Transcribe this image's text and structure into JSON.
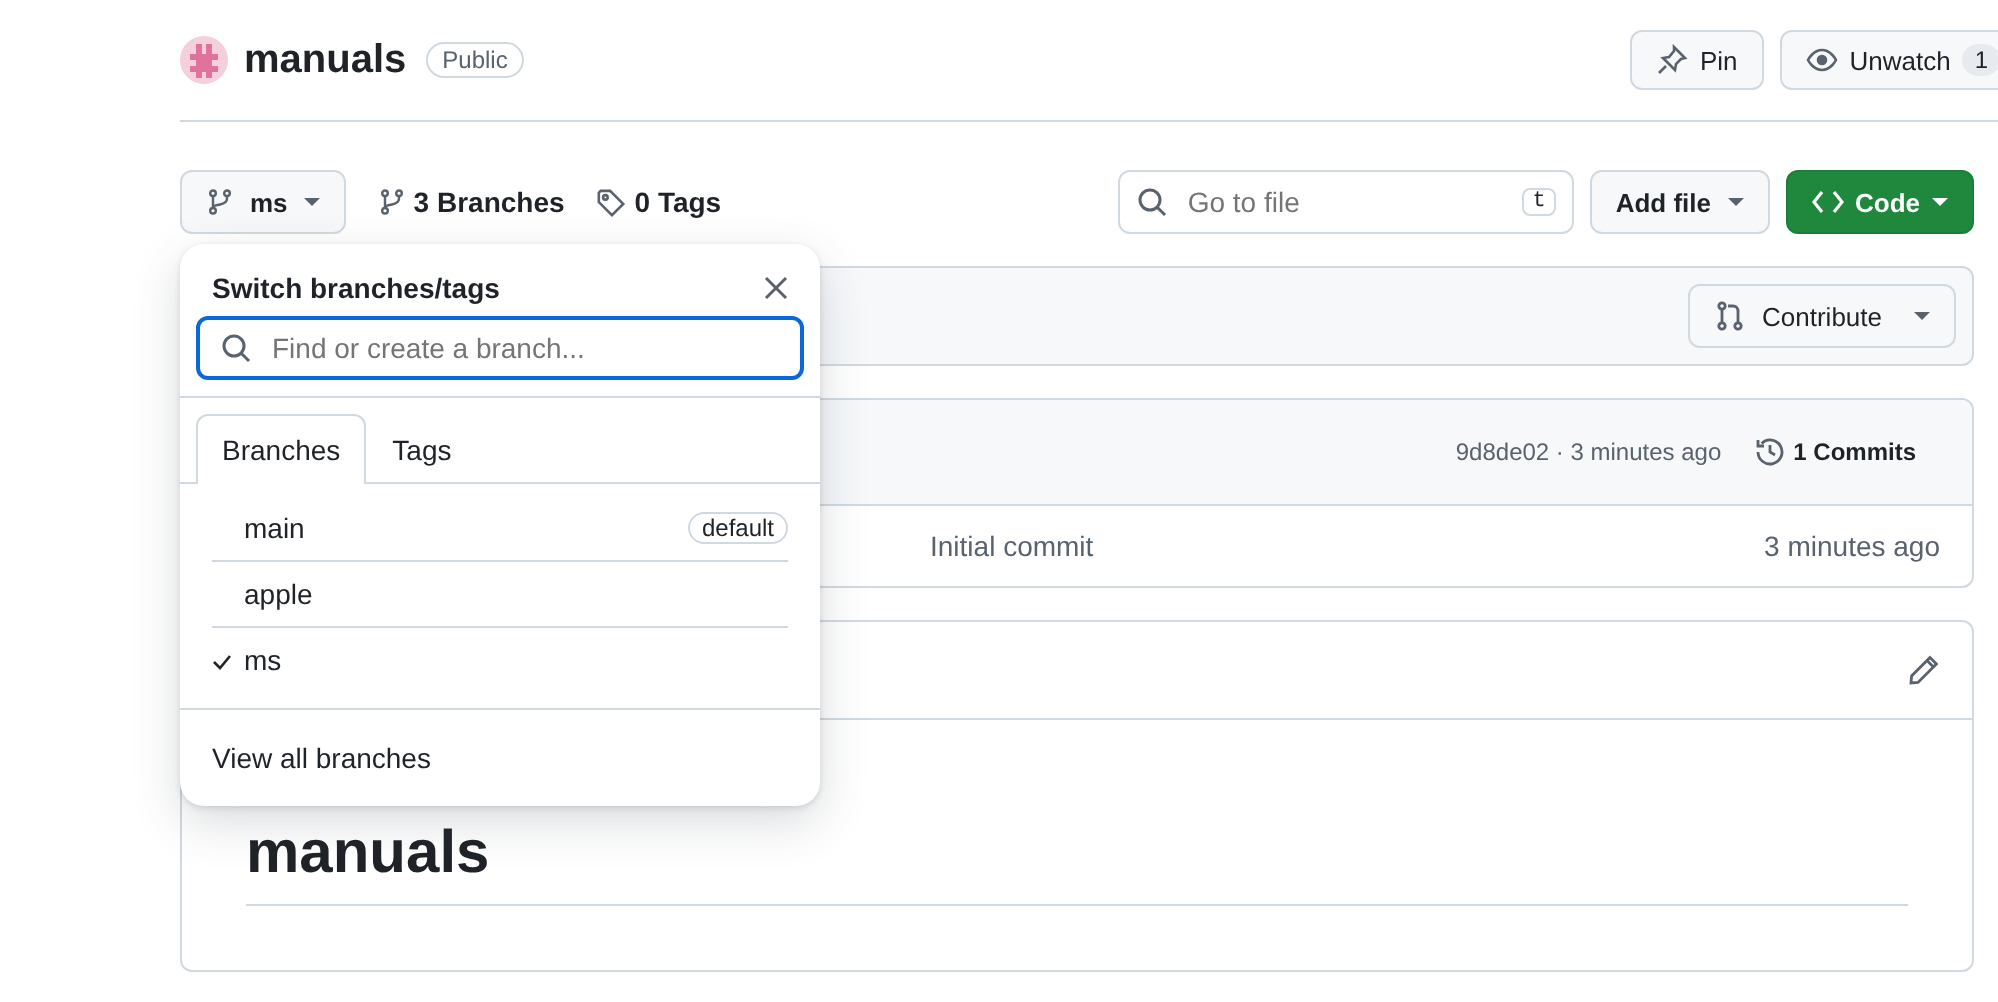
{
  "repo": {
    "name": "manuals",
    "visibility": "Public"
  },
  "actions": {
    "pin": "Pin",
    "unwatch": "Unwatch",
    "watch_count": "1"
  },
  "toolbar": {
    "branch": "ms",
    "branches_count": "3 Branches",
    "tags_count": "0 Tags",
    "search": {
      "placeholder": "Go to file",
      "shortcut": "t"
    },
    "add_file": "Add file",
    "code": "Code"
  },
  "branch_menu": {
    "title": "Switch branches/tags",
    "search": {
      "placeholder": "Find or create a branch..."
    },
    "tabs": [
      {
        "label": "Branches",
        "selected": true
      },
      {
        "label": "Tags",
        "selected": false
      }
    ],
    "items": [
      {
        "name": "main",
        "badge": "default",
        "checked": false
      },
      {
        "name": "apple",
        "checked": false
      },
      {
        "name": "ms",
        "checked": true
      }
    ],
    "footer": "View all branches"
  },
  "contribute": "Contribute",
  "commit_bar": {
    "summary": "9d8de02 · 3 minutes ago",
    "commits": "1 Commits"
  },
  "files": [
    {
      "message": "Initial commit",
      "time": "3 minutes ago"
    }
  ],
  "readme": {
    "heading": "manuals"
  }
}
